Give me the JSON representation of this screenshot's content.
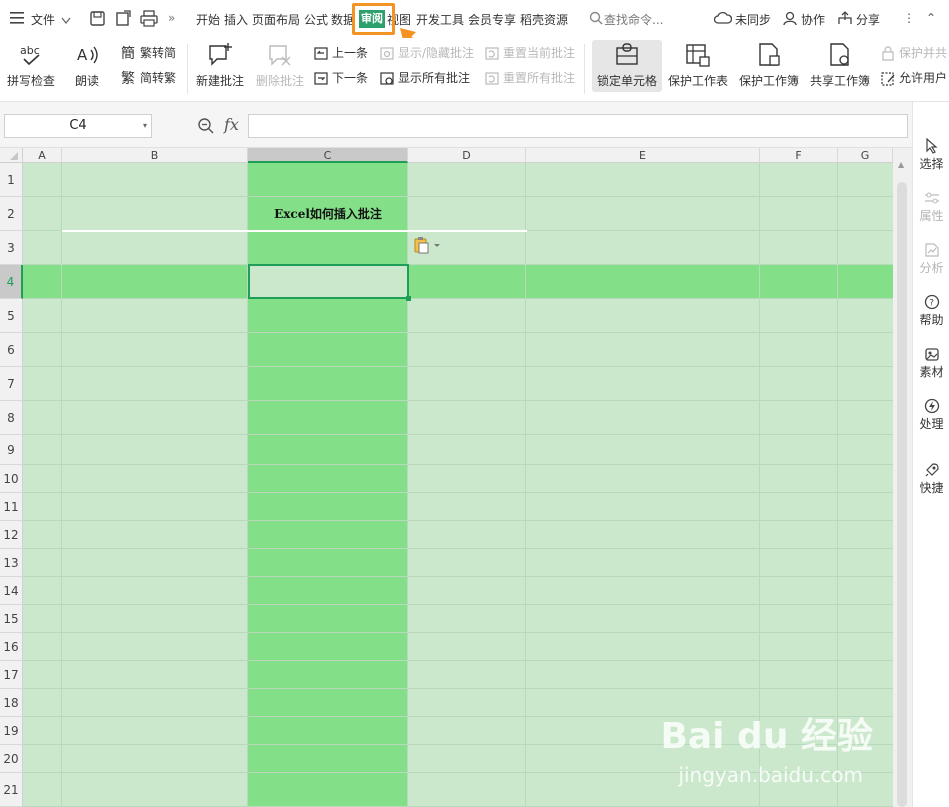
{
  "menubar": {
    "file_label": "文件",
    "tabs": [
      "开始",
      "插入",
      "页面布局",
      "公式",
      "数据",
      "审阅",
      "视图",
      "开发工具",
      "会员专享",
      "稻壳资源"
    ],
    "active_tab": "审阅",
    "search_placeholder": "查找命令...",
    "sync_label": "未同步",
    "collab_label": "协作",
    "share_label": "分享"
  },
  "ribbon": {
    "spellcheck": "拼写检查",
    "read_aloud": "朗读",
    "trad_to_simp": "繁转简",
    "simp_to_trad": "简转繁",
    "new_comment": "新建批注",
    "delete_comment": "删除批注",
    "prev": "上一条",
    "next": "下一条",
    "show_hide_comment": "显示/隐藏批注",
    "show_all_comments": "显示所有批注",
    "reset_current": "重置当前批注",
    "reset_all": "重置所有批注",
    "lock_cell": "锁定单元格",
    "protect_sheet": "保护工作表",
    "protect_book": "保护工作簿",
    "share_book": "共享工作簿",
    "protect_share": "保护并共",
    "allow_edit": "允许用户"
  },
  "formula": {
    "cell_ref": "C4",
    "fx": "fx"
  },
  "sheet": {
    "columns": [
      "A",
      "B",
      "C",
      "D",
      "E",
      "F",
      "G"
    ],
    "rows": [
      "1",
      "2",
      "3",
      "4",
      "5",
      "6",
      "7",
      "8",
      "9",
      "10",
      "11",
      "12",
      "13",
      "14",
      "15",
      "16",
      "17",
      "18",
      "19",
      "20",
      "21"
    ],
    "cell_c2": "Excel如何插入批注"
  },
  "side": {
    "select": "选择",
    "props": "属性",
    "analyze": "分析",
    "help": "帮助",
    "material": "素材",
    "process": "处理",
    "quick": "快捷"
  },
  "watermark": {
    "main": "Bai du 经验",
    "sub": "jingyan.baidu.com"
  },
  "colors": {
    "active_tab": "#2ea06b",
    "highlight_box": "#f39422",
    "grid_fill": "#cbe8cd",
    "selection_fill": "#84e088"
  }
}
